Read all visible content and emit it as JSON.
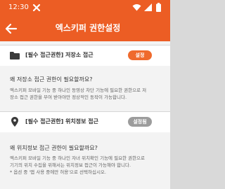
{
  "status_bar": {
    "time": "12:30"
  },
  "toolbar": {
    "title": "엑스키퍼 권한설정"
  },
  "permissions": [
    {
      "header": "[필수 접근권한] 저장소 접근",
      "button_label": "설정",
      "question": "왜 저장소 접근 권한이 필요할까요?",
      "description_lines": [
        "엑스키퍼 모바일 기능 중 하나인 동영상 차단 기능에 필요한 권한으로 저",
        "장소 접근 권한을 부여 받아야만 정상적인 동작이 가능합니다."
      ]
    },
    {
      "header": "[필수 접근권한] 위치정보 접근",
      "button_label": "설정됨",
      "question": "왜 위치정보 접근 권한이 필요할까요?",
      "description_lines": [
        "엑스키퍼 모바일 기능 중 하나인 자녀 위치확인 기능에 필요한 권한으로",
        "기기의 위치 수집을 위해서는 위치정보 접근이 가능해야 합니다.",
        "* 옵션 중 '앱 사용 중에만 허용'으로 선택하십시오."
      ]
    }
  ]
}
